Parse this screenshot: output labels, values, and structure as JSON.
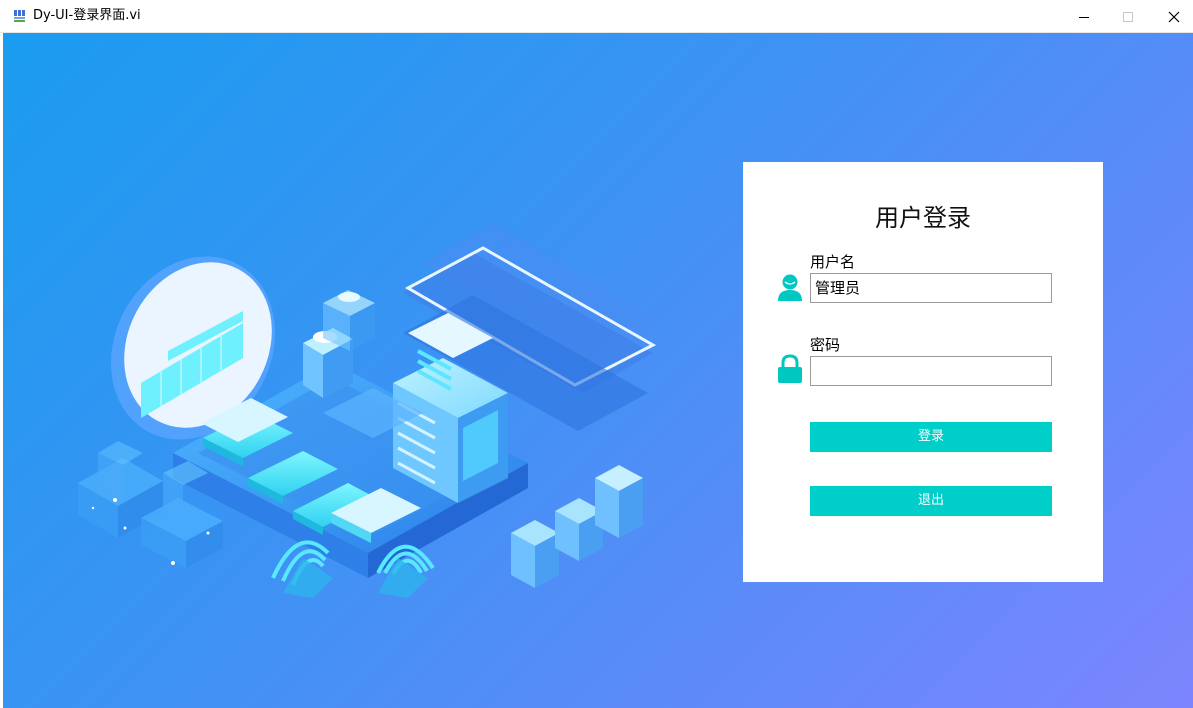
{
  "window": {
    "title": "Dy-UI-登录界面.vi",
    "icon": "labview-vi-icon",
    "controls": [
      "minimize-icon",
      "maximize-icon",
      "close-icon"
    ]
  },
  "login": {
    "heading": "用户登录",
    "username_label": "用户名",
    "username_value": "管理员",
    "password_label": "密码",
    "password_value": "",
    "login_button": "登录",
    "exit_button": "退出"
  },
  "colors": {
    "background_start": "#1a9cf0",
    "background_end": "#7d85fd",
    "accent": "#00cec9",
    "panel": "#ffffff"
  }
}
